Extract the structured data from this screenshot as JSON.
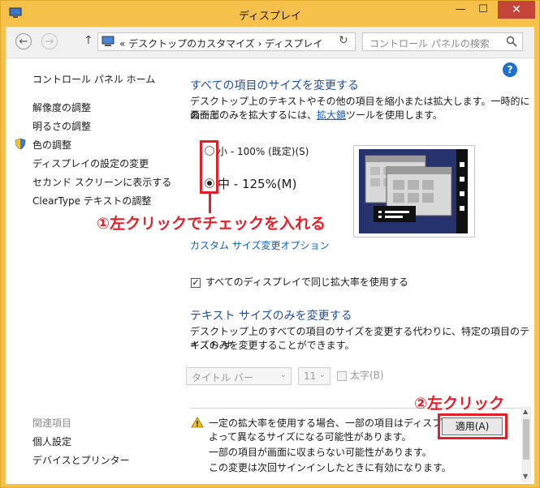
{
  "window": {
    "title": "ディスプレイ",
    "minimize": "—",
    "maximize": "☐",
    "close": "✕"
  },
  "nav": {
    "back": "←",
    "forward": "→",
    "up": "↑",
    "address": "«  デスクトップのカスタマイズ  ›  ディスプレイ",
    "dropdown": "⌄",
    "refresh": "↻",
    "search_placeholder": "コントロール パネルの検索"
  },
  "help": "?",
  "sidebar": {
    "home": "コントロール パネル ホーム",
    "items": [
      {
        "label": "解像度の調整"
      },
      {
        "label": "明るさの調整"
      },
      {
        "label": "色の調整"
      },
      {
        "label": "ディスプレイの設定の変更"
      },
      {
        "label": "セカンド スクリーンに表示する"
      },
      {
        "label": "ClearType テキストの調整"
      }
    ],
    "related_heading": "関連項目",
    "related": [
      {
        "label": "個人設定"
      },
      {
        "label": "デバイスとプリンター"
      }
    ]
  },
  "main": {
    "heading_all": "すべての項目のサイズを変更する",
    "desc_line1": "デスクトップ上のテキストやその他の項目を縮小または拡大します。一時的に画面上",
    "desc_line2_pre": "の一部のみを拡大するには、",
    "desc_link": "拡大鏡",
    "desc_line2_post": "ツールを使用します。",
    "options": [
      {
        "label": "小 - 100% (既定)(S)",
        "selected": false
      },
      {
        "label": "中 - 125%(M)",
        "selected": true
      }
    ],
    "custom_link": "カスタム サイズ変更オプション",
    "same_scale_label": "すべてのディスプレイで同じ拡大率を使用する",
    "same_scale_checked": true,
    "heading_text": "テキスト サイズのみを変更する",
    "text_desc_line1": "デスクトップ上のすべての項目のサイズを変更する代わりに、特定の項目のテキスト サ",
    "text_desc_line2": "イズのみを変更することができます。",
    "item_select": "タイトル バー",
    "size_select": "11",
    "bold_label": "太字(B)",
    "warning_line1": "一定の拡大率を使用する場合、一部の項目はディスプレイに",
    "warning_line2": "よって異なるサイズになる可能性があります。",
    "warning_line3": "一部の項目が画面に収まらない可能性があります。",
    "warning_line4": "この変更は次回サインインしたときに有効になります。",
    "apply_label": "適用(A)"
  },
  "annotations": {
    "step1": "①左クリックでチェックを入れる",
    "step2": "②左クリック"
  },
  "colors": {
    "titlebar": "#f6c14b",
    "accent_heading": "#1f4e9c",
    "link": "#0b5fbf",
    "annotation_red": "#e3202a",
    "preview_navy": "#26336f"
  }
}
